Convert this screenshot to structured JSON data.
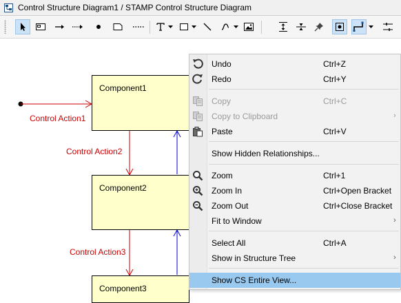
{
  "window": {
    "title": "Control Structure Diagram1 / STAMP Control Structure Diagram"
  },
  "toolbar": {
    "items": [
      "pointer-tool-icon",
      "component-tool-icon",
      "arrow-tool-icon",
      "dotted-arrow-tool-icon",
      "point-tool-icon",
      "note-tool-icon",
      "dotted-line-tool-icon",
      "text-tool-icon",
      "rectangle-tool-icon",
      "line-tool-icon",
      "curve-tool-icon",
      "image-tool-icon",
      "align-vertical-icon",
      "align-horizontal-icon",
      "pin-icon",
      "snap-icon",
      "line-style-icon"
    ]
  },
  "diagram": {
    "components": [
      {
        "label": "Component1"
      },
      {
        "label": "Component2"
      },
      {
        "label": "Component3"
      }
    ],
    "control_actions": [
      {
        "label": "Control Action1"
      },
      {
        "label": "Control Action2"
      },
      {
        "label": "Control Action3"
      }
    ],
    "colors": {
      "component_fill": "#ffffcc",
      "control_action": "#cc0000",
      "feedback": "#0000cc"
    }
  },
  "context_menu": {
    "items": [
      {
        "label": "Undo",
        "shortcut": "Ctrl+Z",
        "icon": "undo-icon",
        "enabled": true
      },
      {
        "label": "Redo",
        "shortcut": "Ctrl+Y",
        "icon": "redo-icon",
        "enabled": true
      },
      {
        "label": "Copy",
        "shortcut": "Ctrl+C",
        "icon": "copy-icon",
        "enabled": false
      },
      {
        "label": "Copy to Clipboard",
        "shortcut": "",
        "icon": "copy-clipboard-icon",
        "enabled": false,
        "submenu": true
      },
      {
        "label": "Paste",
        "shortcut": "Ctrl+V",
        "icon": "paste-icon",
        "enabled": true
      },
      {
        "label": "Show Hidden Relationships...",
        "shortcut": "",
        "icon": "",
        "enabled": true
      },
      {
        "label": "Zoom",
        "shortcut": "Ctrl+1",
        "icon": "zoom-icon",
        "enabled": true
      },
      {
        "label": "Zoom In",
        "shortcut": "Ctrl+Open Bracket",
        "icon": "zoom-in-icon",
        "enabled": true
      },
      {
        "label": "Zoom Out",
        "shortcut": "Ctrl+Close Bracket",
        "icon": "zoom-out-icon",
        "enabled": true
      },
      {
        "label": "Fit to Window",
        "shortcut": "",
        "icon": "",
        "enabled": true,
        "submenu": true
      },
      {
        "label": "Select All",
        "shortcut": "Ctrl+A",
        "icon": "",
        "enabled": true
      },
      {
        "label": "Show in Structure Tree",
        "shortcut": "",
        "icon": "",
        "enabled": true,
        "submenu": true
      },
      {
        "label": "Show CS Entire View...",
        "shortcut": "",
        "icon": "",
        "enabled": true,
        "highlighted": true
      }
    ],
    "submenu_arrow": "›"
  }
}
